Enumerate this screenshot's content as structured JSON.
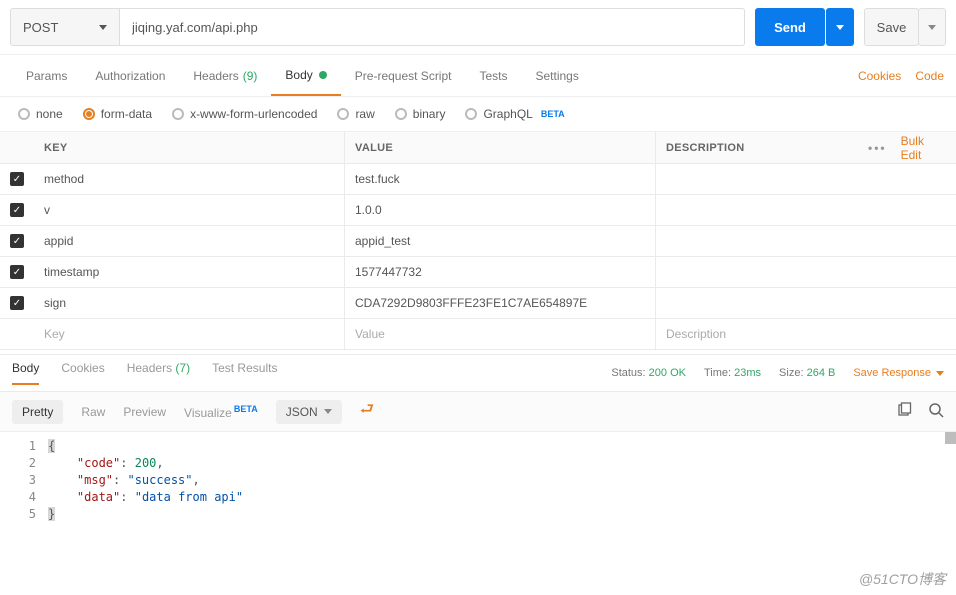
{
  "request": {
    "method": "POST",
    "url": "jiqing.yaf.com/api.php",
    "send_label": "Send",
    "save_label": "Save"
  },
  "tabs": {
    "params": "Params",
    "authorization": "Authorization",
    "headers": "Headers",
    "headers_count": "(9)",
    "body": "Body",
    "prerequest": "Pre-request Script",
    "tests": "Tests",
    "settings": "Settings",
    "cookies": "Cookies",
    "code": "Code"
  },
  "body_types": {
    "none": "none",
    "formdata": "form-data",
    "urlencoded": "x-www-form-urlencoded",
    "raw": "raw",
    "binary": "binary",
    "graphql": "GraphQL",
    "beta": "BETA"
  },
  "kv": {
    "headers": {
      "key": "KEY",
      "value": "VALUE",
      "description": "DESCRIPTION",
      "bulk_edit": "Bulk Edit"
    },
    "rows": [
      {
        "key": "method",
        "value": "test.fuck"
      },
      {
        "key": "v",
        "value": "1.0.0"
      },
      {
        "key": "appid",
        "value": "appid_test"
      },
      {
        "key": "timestamp",
        "value": "1577447732"
      },
      {
        "key": "sign",
        "value": "CDA7292D9803FFFE23FE1C7AE654897E"
      }
    ],
    "placeholders": {
      "key": "Key",
      "value": "Value",
      "description": "Description"
    }
  },
  "response": {
    "tabs": {
      "body": "Body",
      "cookies": "Cookies",
      "headers": "Headers",
      "headers_count": "(7)",
      "tests": "Test Results"
    },
    "status_label": "Status:",
    "status_value": "200 OK",
    "time_label": "Time:",
    "time_value": "23ms",
    "size_label": "Size:",
    "size_value": "264 B",
    "save_response": "Save Response"
  },
  "viewer": {
    "pretty": "Pretty",
    "raw": "Raw",
    "preview": "Preview",
    "visualize": "Visualize",
    "beta": "BETA",
    "format": "JSON"
  },
  "json_body": {
    "code_label": "\"code\"",
    "code_value": "200",
    "msg_label": "\"msg\"",
    "msg_value": "\"success\"",
    "data_label": "\"data\"",
    "data_value": "\"data from api\""
  },
  "watermark": "@51CTO博客"
}
